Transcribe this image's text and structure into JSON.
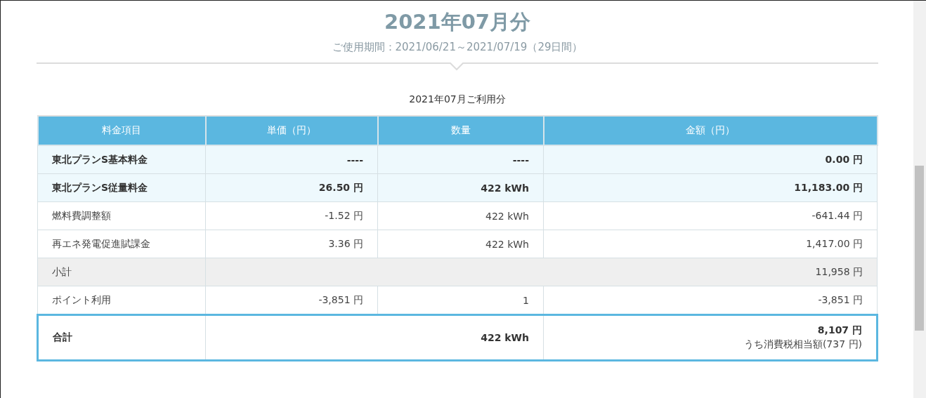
{
  "title": "2021年07月分",
  "period": "ご使用期間：2021/06/21～2021/07/19（29日間）",
  "table": {
    "caption": "2021年07月ご利用分",
    "columns": [
      "料金項目",
      "単価（円）",
      "数量",
      "金額（円）"
    ],
    "rows": [
      {
        "kind": "plan",
        "item": "東北プランS基本料金",
        "unit_price": "----",
        "quantity": "----",
        "amount": "0.00 円"
      },
      {
        "kind": "plan",
        "item": "東北プランS従量料金",
        "unit_price": "26.50 円",
        "quantity": "422 kWh",
        "amount": "11,183.00 円"
      },
      {
        "kind": "normal",
        "item": "燃料費調整額",
        "unit_price": "-1.52 円",
        "quantity": "422 kWh",
        "amount": "-641.44 円"
      },
      {
        "kind": "normal",
        "item": "再エネ発電促進賦課金",
        "unit_price": "3.36 円",
        "quantity": "422 kWh",
        "amount": "1,417.00 円"
      },
      {
        "kind": "subtotal",
        "item": "小計",
        "amount": "11,958 円"
      },
      {
        "kind": "normal",
        "item": "ポイント利用",
        "unit_price": "-3,851 円",
        "quantity": "1",
        "amount": "-3,851 円"
      }
    ],
    "total": {
      "item": "合計",
      "quantity": "422 kWh",
      "amount": "8,107 円",
      "tax_note": "うち消費税相当額(737 円)"
    }
  }
}
